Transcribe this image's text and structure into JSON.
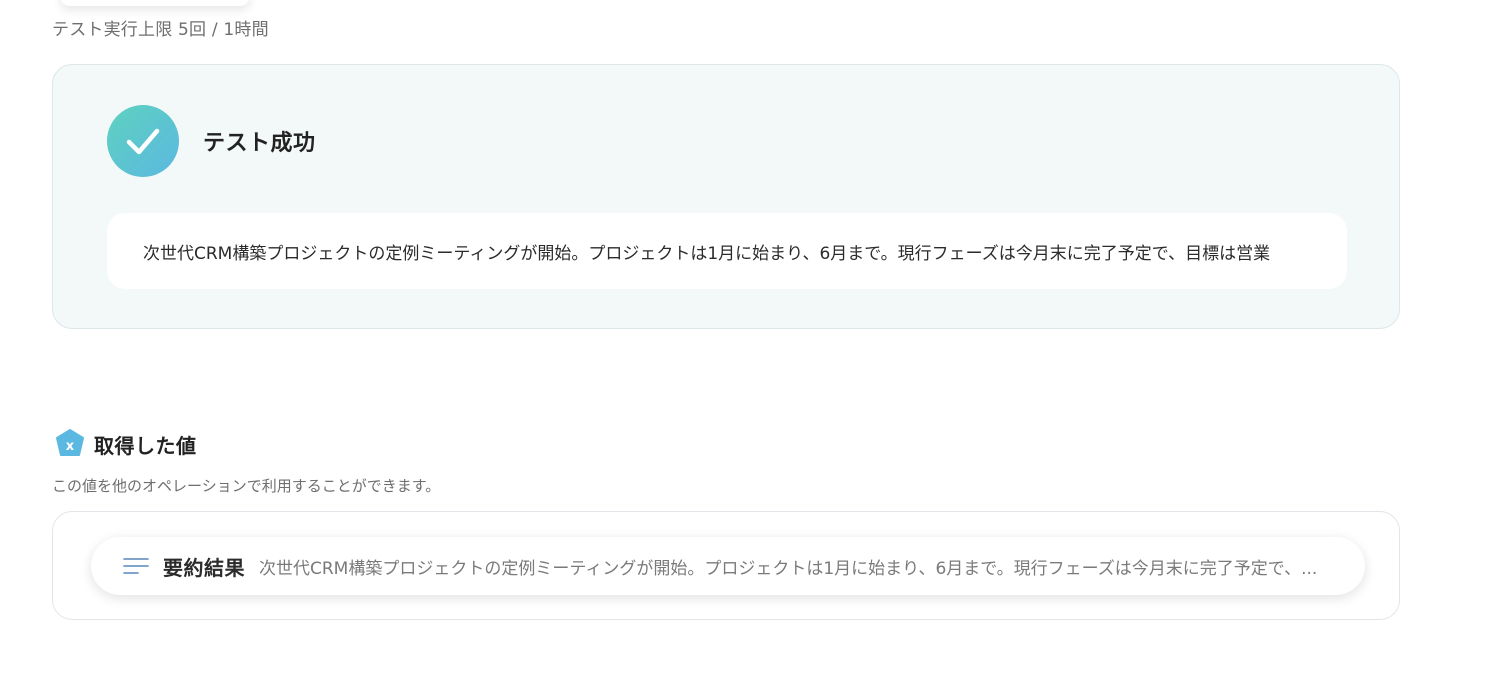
{
  "test": {
    "limit_text": "テスト実行上限 5回 / 1時間",
    "success_title": "テスト成功",
    "summary_text": "次世代CRM構築プロジェクトの定例ミーティングが開始。プロジェクトは1月に始まり、6月まで。現行フェーズは今月末に完了予定で、目標は営業"
  },
  "acquired": {
    "title": "取得した値",
    "description": "この値を他のオペレーションで利用することができます。",
    "items": [
      {
        "label": "要約結果",
        "value": "次世代CRM構築プロジェクトの定例ミーティングが開始。プロジェクトは1月に始まり、6月まで。現行フェーズは今月末に完了予定で、..."
      }
    ]
  },
  "icons": {
    "success": "check-icon",
    "acquired": "variable-icon",
    "value_item": "lines-icon"
  },
  "colors": {
    "success_gradient_start": "#5ed2bf",
    "success_gradient_end": "#5bb8e0",
    "card_background": "#f3f8f8",
    "acquired_icon": "#5bb8e0"
  }
}
